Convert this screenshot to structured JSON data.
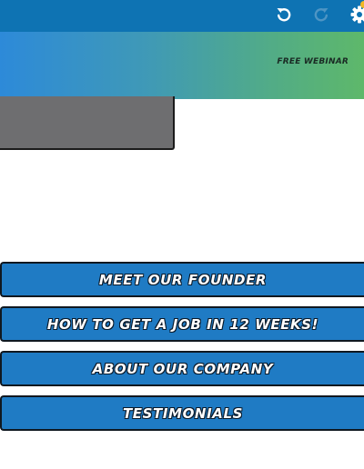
{
  "toolbar": {
    "icons": [
      "undo-icon",
      "redo-icon",
      "settings-icon"
    ],
    "colors": {
      "bar": "#0e73b3",
      "notification": "#f2b826"
    }
  },
  "banner": {
    "text": "FREE WEBINAR",
    "colors": {
      "gradient_start": "#2d8ad9",
      "gradient_end": "#5eb86a"
    }
  },
  "menu": {
    "items": [
      {
        "label": "MEET OUR FOUNDER"
      },
      {
        "label": "HOW TO GET A JOB IN 12 WEEKS!"
      },
      {
        "label": "ABOUT OUR COMPANY"
      },
      {
        "label": "TESTIMONIALS"
      }
    ],
    "colors": {
      "button": "#1f7bc4",
      "border": "#101820"
    }
  }
}
